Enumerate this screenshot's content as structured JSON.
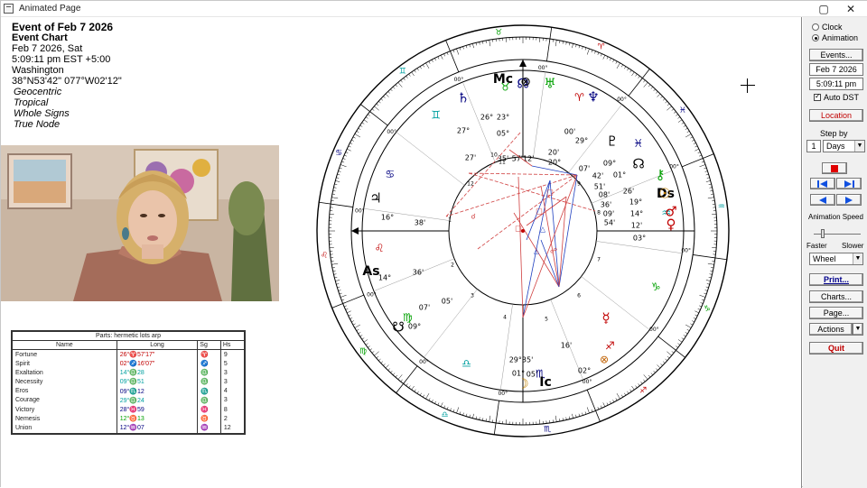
{
  "window": {
    "title": "Animated Page",
    "restore_glyph": "▢",
    "close_glyph": "✕"
  },
  "chart_info": {
    "title": "Event of Feb 7 2026",
    "subtitle": "Event Chart",
    "date": "Feb 7 2026, Sat",
    "time": "5:09:11 pm  EST +5:00",
    "place": "Washington",
    "coords": "38°N53'42\" 077°W02'12\"",
    "options": [
      "Geocentric",
      "Tropical",
      "Whole Signs",
      "True Node"
    ]
  },
  "parts_table": {
    "caption": "Parts: hermetic lots arp",
    "headers": [
      "Name",
      "Long",
      "Sg",
      "Hs"
    ],
    "rows": [
      {
        "name": "Fortune",
        "long": "26°♈57'17\"",
        "sg": "♈",
        "hs": "9",
        "color": "#c00000"
      },
      {
        "name": "Spirit",
        "long": "02°♐16'07\"",
        "sg": "♐",
        "hs": "5",
        "color": "#c00000"
      },
      {
        "name": "Exaltation",
        "long": "14°♎28",
        "sg": "♎",
        "hs": "3",
        "color": "#00a0a0"
      },
      {
        "name": "Necessity",
        "long": "09°♎51",
        "sg": "♎",
        "hs": "3",
        "color": "#00a0a0"
      },
      {
        "name": "Eros",
        "long": "09°♏12",
        "sg": "♏",
        "hs": "4",
        "color": "#000080"
      },
      {
        "name": "Courage",
        "long": "29°♎24",
        "sg": "♎",
        "hs": "3",
        "color": "#00a0a0"
      },
      {
        "name": "Victory",
        "long": "28°♓59",
        "sg": "♓",
        "hs": "8",
        "color": "#000080"
      },
      {
        "name": "Nemesis",
        "long": "12°♉13",
        "sg": "♉",
        "hs": "2",
        "color": "#00a000"
      },
      {
        "name": "Union",
        "long": "12°♒07",
        "sg": "♒",
        "hs": "12",
        "color": "#000080"
      }
    ]
  },
  "wheel": {
    "angles": {
      "mc": "Mc",
      "ic": "Ic",
      "as": "As",
      "ds": "Ds"
    },
    "cusp_numbers": [
      "9",
      "10",
      "11",
      "12",
      "1",
      "2",
      "3",
      "4",
      "5",
      "6",
      "7",
      "8"
    ],
    "rim_label": "00°",
    "sign_glyphs": [
      "♈",
      "♉",
      "♊",
      "♋",
      "♌",
      "♍",
      "♎",
      "♏",
      "♐",
      "♑",
      "♒",
      "♓"
    ],
    "labels": [
      {
        "t": "26°",
        "c": "#000"
      },
      {
        "t": "23°",
        "c": "#000"
      },
      {
        "t": "05°",
        "c": "#000"
      },
      {
        "t": "35'",
        "c": "#000"
      },
      {
        "t": "57'12'",
        "c": "#000"
      },
      {
        "t": "27°",
        "c": "#000"
      },
      {
        "t": "27'",
        "c": "#000"
      },
      {
        "t": "00'",
        "c": "#000"
      },
      {
        "t": "29°",
        "c": "#000"
      },
      {
        "t": "20'",
        "c": "#000"
      },
      {
        "t": "20°",
        "c": "#000"
      },
      {
        "t": "09°",
        "c": "#000"
      },
      {
        "t": "01°",
        "c": "#000"
      },
      {
        "t": "07'",
        "c": "#000"
      },
      {
        "t": "42'",
        "c": "#000"
      },
      {
        "t": "26'",
        "c": "#000"
      },
      {
        "t": "51'",
        "c": "#000"
      },
      {
        "t": "19°",
        "c": "#000"
      },
      {
        "t": "08'",
        "c": "#000"
      },
      {
        "t": "14°",
        "c": "#000"
      },
      {
        "t": "36'",
        "c": "#000"
      },
      {
        "t": "12'",
        "c": "#000"
      },
      {
        "t": "09'",
        "c": "#000"
      },
      {
        "t": "54'",
        "c": "#000"
      },
      {
        "t": "03°",
        "c": "#000"
      },
      {
        "t": "16°",
        "c": "#000"
      },
      {
        "t": "38'",
        "c": "#000"
      },
      {
        "t": "14°",
        "c": "#000"
      },
      {
        "t": "36'",
        "c": "#000"
      },
      {
        "t": "07'",
        "c": "#000"
      },
      {
        "t": "05'",
        "c": "#000"
      },
      {
        "t": "09°",
        "c": "#000"
      },
      {
        "t": "29°35'",
        "c": "#000"
      },
      {
        "t": "01°",
        "c": "#000"
      },
      {
        "t": "05'",
        "c": "#000"
      },
      {
        "t": "16'",
        "c": "#000"
      },
      {
        "t": "02°",
        "c": "#000"
      }
    ],
    "colors": {
      "fire": "#c00000",
      "earth": "#00a000",
      "air": "#00a0a0",
      "water": "#000080",
      "aspect_red": "#d04040",
      "aspect_blue": "#2040c0"
    }
  },
  "panel": {
    "clock_label": "Clock",
    "animation_label": "Animation",
    "events_label": "Events...",
    "date_value": "Feb 7 2026",
    "time_value": "5:09:11 pm",
    "auto_dst_label": "Auto DST",
    "location_label": "Location",
    "step_by_label": "Step by",
    "step_value": "1",
    "step_unit": "Days",
    "animation_speed_label": "Animation Speed",
    "faster_label": "Faster",
    "slower_label": "Slower",
    "mode_value": "Wheel",
    "print_label": "Print...",
    "charts_label": "Charts...",
    "page_label": "Page...",
    "actions_label": "Actions",
    "quit_label": "Quit"
  }
}
